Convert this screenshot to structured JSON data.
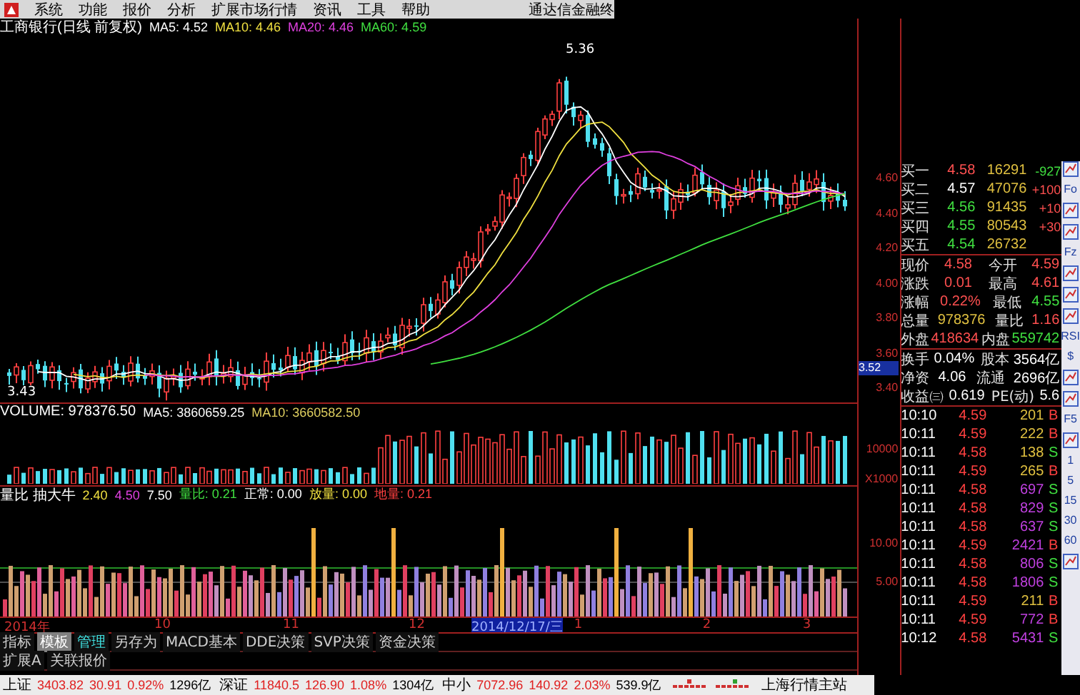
{
  "menu_bar": {
    "items": [
      "系统",
      "功能",
      "报价",
      "分析",
      "扩展市场行情",
      "资讯",
      "工具",
      "帮助"
    ],
    "app_title": "通达信金融终"
  },
  "chart_header": {
    "title": "工商银行(日线 前复权)",
    "indicators": [
      {
        "label": "MA5: 4.52",
        "color": "#ffffff"
      },
      {
        "label": "MA10: 4.46",
        "color": "#f0e040"
      },
      {
        "label": "MA20: 4.46",
        "color": "#e040e0"
      },
      {
        "label": "MA60: 4.59",
        "color": "#40e040"
      }
    ]
  },
  "price_axis": {
    "ticks": [
      "4.60",
      "4.40",
      "4.20",
      "4.00",
      "3.80",
      "3.60",
      "3.40"
    ],
    "current_price": "3.52",
    "high_label": "5.36",
    "low_label": "3.43"
  },
  "volume_panel": {
    "title": "VOLUME: 978376.50",
    "indicators": [
      {
        "label": "MA5: 3860659.25",
        "color": "#ffffff"
      },
      {
        "label": "MA10: 3660582.50",
        "color": "#e0d060"
      }
    ],
    "ticks": [
      "10000",
      "X1000"
    ]
  },
  "indicator_panel": {
    "items": [
      {
        "label": "量比 抽大牛",
        "color": "#ffffff"
      },
      {
        "label": "2.40",
        "color": "#f0e040"
      },
      {
        "label": "4.50",
        "color": "#e040e0"
      },
      {
        "label": "7.50",
        "color": "#ffffff"
      },
      {
        "label": "量比: 0.21",
        "color": "#40e040"
      },
      {
        "label": "正常: 0.00",
        "color": "#ffffff"
      },
      {
        "label": "放量: 0.00",
        "color": "#f0e040"
      },
      {
        "label": "地量: 0.21",
        "color": "#ff4040"
      }
    ],
    "ticks": [
      "10.00",
      "5.00"
    ]
  },
  "date_axis": [
    {
      "label": "2014年",
      "highlighted": false
    },
    {
      "label": "10",
      "highlighted": false
    },
    {
      "label": "11",
      "highlighted": false
    },
    {
      "label": "12",
      "highlighted": false
    },
    {
      "label": "2014/12/17/三",
      "highlighted": true
    },
    {
      "label": "1",
      "highlighted": false
    },
    {
      "label": "2",
      "highlighted": false
    },
    {
      "label": "3",
      "highlighted": false
    }
  ],
  "template_tabs": [
    {
      "label": "指标",
      "selected": false,
      "highlighted": false
    },
    {
      "label": "模板",
      "selected": true,
      "highlighted": false
    },
    {
      "label": "管理",
      "selected": false,
      "highlighted": true
    },
    {
      "label": "另存为",
      "selected": false,
      "highlighted": false
    },
    {
      "label": "MACD基本",
      "selected": false,
      "highlighted": false
    },
    {
      "label": "DDE决策",
      "selected": false,
      "highlighted": false
    },
    {
      "label": "SVP决策",
      "selected": false,
      "highlighted": false
    },
    {
      "label": "资金决策",
      "selected": false,
      "highlighted": false
    }
  ],
  "extension_tabs": [
    {
      "label": "扩展A",
      "selected": false
    },
    {
      "label": "关联报价",
      "selected": false
    }
  ],
  "order_book": [
    {
      "label": "买一",
      "price": "4.58",
      "color": "#ff5050",
      "volume": "16291",
      "change": {
        "text": "-927",
        "color": "#40e040"
      }
    },
    {
      "label": "买二",
      "price": "4.57",
      "color": "#ffffff",
      "volume": "47076",
      "change": {
        "text": "+100",
        "color": "#ff5050"
      }
    },
    {
      "label": "买三",
      "price": "4.56",
      "color": "#40e040",
      "volume": "91435",
      "change": {
        "text": "+10",
        "color": "#ff5050"
      }
    },
    {
      "label": "买四",
      "price": "4.55",
      "color": "#40e040",
      "volume": "80543",
      "change": {
        "text": "+30",
        "color": "#ff5050"
      }
    },
    {
      "label": "买五",
      "price": "4.54",
      "color": "#40e040",
      "volume": "26732"
    }
  ],
  "quote_stats": [
    [
      {
        "label": "现价",
        "value": "4.58",
        "color": "#ff5050"
      },
      {
        "label": "今开",
        "value": "4.59",
        "color": "#ff5050"
      }
    ],
    [
      {
        "label": "涨跌",
        "value": "0.01",
        "color": "#ff5050"
      },
      {
        "label": "最高",
        "value": "4.61",
        "color": "#ff5050"
      }
    ],
    [
      {
        "label": "涨幅",
        "value": "0.22%",
        "color": "#ff5050"
      },
      {
        "label": "最低",
        "value": "4.55",
        "color": "#40e040"
      }
    ],
    [
      {
        "label": "总量",
        "value": "978376",
        "color": "#e0c040"
      },
      {
        "label": "量比",
        "value": "1.16",
        "color": "#ff5050"
      }
    ],
    [
      {
        "label": "外盘",
        "value": "418634",
        "color": "#ff5050"
      },
      {
        "label": "内盘",
        "value": "559742",
        "color": "#40e040"
      }
    ]
  ],
  "fundamentals": [
    [
      {
        "label": "换手",
        "value": "0.04%"
      },
      {
        "label": "股本",
        "value": "3564亿"
      }
    ],
    [
      {
        "label": "净资",
        "value": "4.06"
      },
      {
        "label": "流通",
        "value": "2696亿"
      }
    ],
    [
      {
        "label": "收益㈢",
        "value": "0.619"
      },
      {
        "label": "PE(动)",
        "value": "5.6"
      }
    ]
  ],
  "trades": [
    {
      "time": "10:10",
      "price": "4.59",
      "volume": "201",
      "side": "B",
      "large": false
    },
    {
      "time": "10:11",
      "price": "4.59",
      "volume": "222",
      "side": "B",
      "large": false
    },
    {
      "time": "10:11",
      "price": "4.58",
      "volume": "138",
      "side": "S",
      "large": false
    },
    {
      "time": "10:11",
      "price": "4.59",
      "volume": "265",
      "side": "B",
      "large": false
    },
    {
      "time": "10:11",
      "price": "4.58",
      "volume": "697",
      "side": "S",
      "large": true
    },
    {
      "time": "10:11",
      "price": "4.58",
      "volume": "829",
      "side": "S",
      "large": true
    },
    {
      "time": "10:11",
      "price": "4.58",
      "volume": "637",
      "side": "S",
      "large": true
    },
    {
      "time": "10:11",
      "price": "4.59",
      "volume": "2421",
      "side": "B",
      "large": true
    },
    {
      "time": "10:11",
      "price": "4.58",
      "volume": "806",
      "side": "S",
      "large": true
    },
    {
      "time": "10:11",
      "price": "4.58",
      "volume": "1806",
      "side": "S",
      "large": true
    },
    {
      "time": "10:11",
      "price": "4.59",
      "volume": "211",
      "side": "B",
      "large": false
    },
    {
      "time": "10:11",
      "price": "4.59",
      "volume": "772",
      "side": "B",
      "large": true
    },
    {
      "time": "10:12",
      "price": "4.58",
      "volume": "5431",
      "side": "S",
      "large": true
    }
  ],
  "toolbar": [
    {
      "kind": "icon"
    },
    {
      "kind": "text",
      "label": "Fo"
    },
    {
      "kind": "icon"
    },
    {
      "kind": "icon"
    },
    {
      "kind": "text",
      "label": "Fz"
    },
    {
      "kind": "icon"
    },
    {
      "kind": "icon"
    },
    {
      "kind": "icon"
    },
    {
      "kind": "text",
      "label": "RSI"
    },
    {
      "kind": "text",
      "label": "$"
    },
    {
      "kind": "icon"
    },
    {
      "kind": "icon"
    },
    {
      "kind": "text",
      "label": "F5"
    },
    {
      "kind": "icon"
    },
    {
      "kind": "text",
      "label": "1"
    },
    {
      "kind": "text",
      "label": "5"
    },
    {
      "kind": "text",
      "label": "15"
    },
    {
      "kind": "text",
      "label": "30"
    },
    {
      "kind": "text",
      "label": "60"
    },
    {
      "kind": "icon"
    }
  ],
  "status_bar": {
    "indices": [
      {
        "name": "上证",
        "value": "3403.82",
        "change": "30.91",
        "percent": "0.92%",
        "amount": "1296亿"
      },
      {
        "name": "深证",
        "value": "11840.5",
        "change": "126.90",
        "percent": "1.08%",
        "amount": "1304亿"
      },
      {
        "name": "中小",
        "value": "7072.96",
        "change": "140.92",
        "percent": "2.03%",
        "amount": "539.9亿"
      }
    ],
    "server": "上海行情主站"
  }
}
